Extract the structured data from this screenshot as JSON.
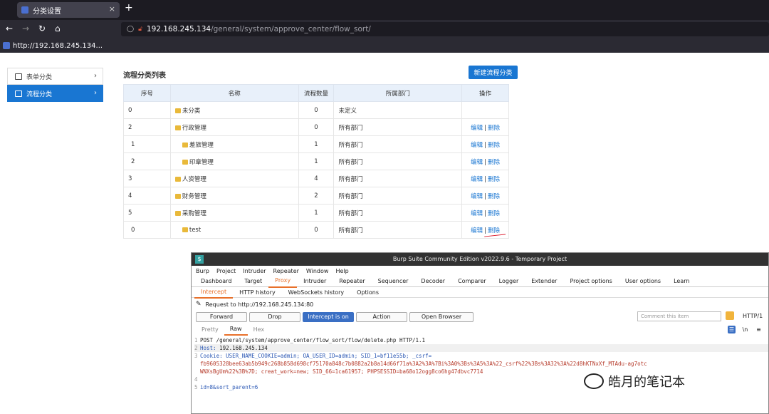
{
  "browser": {
    "tab_title": "分类设置",
    "tab_close": "×",
    "new_tab": "+",
    "url_host": "192.168.245.134",
    "url_path": "/general/system/approve_center/flow_sort/",
    "bookmark": "http://192.168.245.134..."
  },
  "sidebar": {
    "items": [
      {
        "label": "表单分类"
      },
      {
        "label": "流程分类"
      }
    ]
  },
  "main": {
    "title": "流程分类列表",
    "new_button": "新建流程分类",
    "columns": [
      "序号",
      "名称",
      "流程数量",
      "所属部门",
      "操作"
    ],
    "rows": [
      {
        "idx": "0",
        "name": "未分类",
        "count": "0",
        "dept": "未定义",
        "edit": "",
        "sep": "",
        "del": ""
      },
      {
        "idx": "2",
        "name": "行政管理",
        "count": "0",
        "dept": "所有部门",
        "edit": "编辑",
        "sep": "|",
        "del": "删除"
      },
      {
        "idx": "1",
        "name": "差旅管理",
        "count": "1",
        "dept": "所有部门",
        "edit": "编辑",
        "sep": "|",
        "del": "删除"
      },
      {
        "idx": "2",
        "name": "印章管理",
        "count": "1",
        "dept": "所有部门",
        "edit": "编辑",
        "sep": "|",
        "del": "删除"
      },
      {
        "idx": "3",
        "name": "人资管理",
        "count": "4",
        "dept": "所有部门",
        "edit": "编辑",
        "sep": "|",
        "del": "删除"
      },
      {
        "idx": "4",
        "name": "财务管理",
        "count": "2",
        "dept": "所有部门",
        "edit": "编辑",
        "sep": "|",
        "del": "删除"
      },
      {
        "idx": "5",
        "name": "采购管理",
        "count": "1",
        "dept": "所有部门",
        "edit": "编辑",
        "sep": "|",
        "del": "删除"
      },
      {
        "idx": "0",
        "name": "test",
        "count": "0",
        "dept": "所有部门",
        "edit": "编辑",
        "sep": "|",
        "del": "删除"
      }
    ]
  },
  "burp": {
    "title": "Burp Suite Community Edition v2022.9.6 - Temporary Project",
    "menu": [
      "Burp",
      "Project",
      "Intruder",
      "Repeater",
      "Window",
      "Help"
    ],
    "tabs": [
      "Dashboard",
      "Target",
      "Proxy",
      "Intruder",
      "Repeater",
      "Sequencer",
      "Decoder",
      "Comparer",
      "Logger",
      "Extender",
      "Project options",
      "User options",
      "Learn"
    ],
    "subtabs": [
      "Intercept",
      "HTTP history",
      "WebSockets history",
      "Options"
    ],
    "request_to": "Request to http://192.168.245.134:80",
    "buttons": {
      "forward": "Forward",
      "drop": "Drop",
      "intercept": "Intercept is on",
      "action": "Action",
      "open_browser": "Open Browser"
    },
    "comment_placeholder": "Comment this item",
    "http_label": "HTTP/1",
    "view_tabs": [
      "Pretty",
      "Raw",
      "Hex"
    ],
    "view_icon_ln": "\\n",
    "view_icon_menu": "≡",
    "lines": {
      "l1": "POST /general/system/approve_center/flow_sort/flow/delete.php HTTP/1.1",
      "l2_key": "Host: ",
      "l2_val": "192.168.245.134",
      "l3_key": "Cookie: ",
      "l3_val": "USER_NAME_COOKIE=admin; OA_USER_ID=admin; SID_1=bf11e55b; _csrf=",
      "l3b": "fb9605328bee63ab5b949c268b858d698cf75170a848c7b0882a2b8a14d66f71a%3A2%3A%7Bi%3A0%3Bs%3A5%3A%22_csrf%22%3Bs%3A32%3A%22d8hKTNxXf_MTAdu-ag7otc",
      "l3c": "WNXsBgUm%22%3B%7D; creat_work=new; SID_66=1ca61957; PHPSESSID=ba68o12ogg8co6hg47dbvc7714",
      "l5": "id=8&sort_parent=6"
    }
  },
  "watermark": "皓月的笔记本"
}
